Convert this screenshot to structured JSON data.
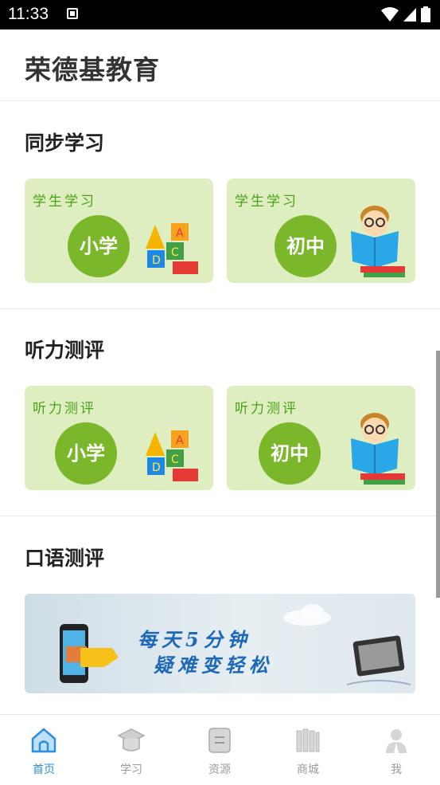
{
  "status": {
    "time": "11:33"
  },
  "app": {
    "title": "荣德基教育"
  },
  "sections": {
    "sync": {
      "title": "同步学习",
      "cards": [
        {
          "label": "学生学习",
          "level": "小学"
        },
        {
          "label": "学生学习",
          "level": "初中"
        }
      ]
    },
    "listening": {
      "title": "听力测评",
      "cards": [
        {
          "label": "听力测评",
          "level": "小学"
        },
        {
          "label": "听力测评",
          "level": "初中"
        }
      ]
    },
    "speaking": {
      "title": "口语测评",
      "banner": {
        "line1": "每天5分钟",
        "line2": "疑难变轻松"
      }
    }
  },
  "tabs": [
    {
      "label": "首页",
      "icon": "home-icon",
      "active": true
    },
    {
      "label": "学习",
      "icon": "graduation-cap-icon",
      "active": false
    },
    {
      "label": "资源",
      "icon": "document-icon",
      "active": false
    },
    {
      "label": "商城",
      "icon": "bookshelf-icon",
      "active": false
    },
    {
      "label": "我",
      "icon": "user-icon",
      "active": false
    }
  ],
  "colors": {
    "accent": "#2b8fe0",
    "card_bg": "#dfeec0",
    "circle": "#7ab72a",
    "card_label": "#4aa21a"
  }
}
